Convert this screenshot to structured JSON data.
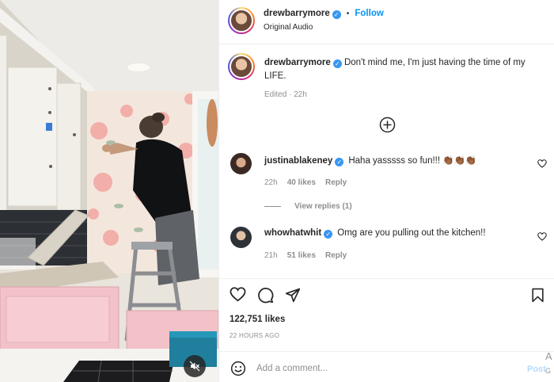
{
  "header": {
    "username": "drewbarrymore",
    "dot": "•",
    "follow_label": "Follow",
    "audio_label": "Original Audio"
  },
  "caption": {
    "username": "drewbarrymore",
    "text": "Don't mind me, I'm just having the time of my LIFE.",
    "edited_label": "Edited",
    "edited_time": "22h"
  },
  "comments": [
    {
      "username": "justinablakeney",
      "text": "Haha yasssss so fun!!! 👏🏾👏🏾👏🏾",
      "time": "22h",
      "likes": "40 likes",
      "reply_label": "Reply",
      "view_replies": "View replies (1)"
    },
    {
      "username": "whowhatwhit",
      "text": "Omg are you pulling out the kitchen!!",
      "time": "21h",
      "likes": "51 likes",
      "reply_label": "Reply"
    }
  ],
  "actions": {
    "icons": [
      "heart-icon",
      "comment-icon",
      "share-icon",
      "bookmark-icon"
    ],
    "likes_count": "122,751 likes",
    "posted_ago": "22 HOURS AGO"
  },
  "composer": {
    "placeholder": "Add a comment...",
    "post_label": "Post",
    "emoji_icon": "smiley-icon"
  },
  "overlay": {
    "corner_letter_top": "A",
    "corner_letter_bottom": "G"
  },
  "colors": {
    "accent": "#0095f6",
    "verified": "#3897f0",
    "muted": "#8e8e8e",
    "post_disabled": "#b3dbff"
  }
}
